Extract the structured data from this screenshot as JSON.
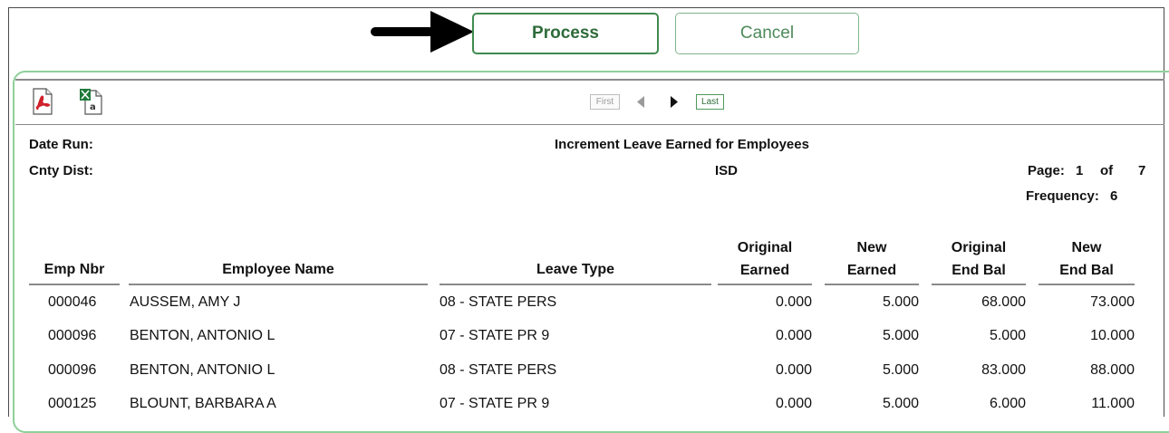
{
  "buttons": {
    "process_label": "Process",
    "cancel_label": "Cancel"
  },
  "icons": {
    "pdf": "pdf-export-icon",
    "excel": "excel-export-icon",
    "arrow": "pointer-arrow-icon"
  },
  "pager": {
    "first_label": "First",
    "last_label": "Last"
  },
  "report": {
    "date_run_label": "Date Run:",
    "cnty_dist_label": "Cnty Dist:",
    "title": "Increment Leave Earned for Employees",
    "district": "ISD",
    "page_label": "Page:",
    "page_current": "1",
    "of_label": "of",
    "page_total": "7",
    "frequency_label": "Frequency:",
    "frequency_value": "6"
  },
  "table": {
    "headers": {
      "emp_nbr": "Emp Nbr",
      "employee_name": "Employee Name",
      "leave_type": "Leave Type",
      "orig_earned_1": "Original",
      "orig_earned_2": "Earned",
      "new_earned_1": "New",
      "new_earned_2": "Earned",
      "orig_end_1": "Original",
      "orig_end_2": "End Bal",
      "new_end_1": "New",
      "new_end_2": "End Bal"
    },
    "rows": [
      {
        "emp": "000046",
        "name": "AUSSEM, AMY J",
        "leave": "08 - STATE PERS",
        "orig_earned": "0.000",
        "new_earned": "5.000",
        "orig_end": "68.000",
        "new_end": "73.000"
      },
      {
        "emp": "000096",
        "name": "BENTON, ANTONIO L",
        "leave": "07 - STATE PR 9",
        "orig_earned": "0.000",
        "new_earned": "5.000",
        "orig_end": "5.000",
        "new_end": "10.000"
      },
      {
        "emp": "000096",
        "name": "BENTON, ANTONIO L",
        "leave": "08 - STATE PERS",
        "orig_earned": "0.000",
        "new_earned": "5.000",
        "orig_end": "83.000",
        "new_end": "88.000"
      },
      {
        "emp": "000125",
        "name": "BLOUNT, BARBARA A",
        "leave": "07 - STATE PR 9",
        "orig_earned": "0.000",
        "new_earned": "5.000",
        "orig_end": "6.000",
        "new_end": "11.000"
      }
    ]
  }
}
